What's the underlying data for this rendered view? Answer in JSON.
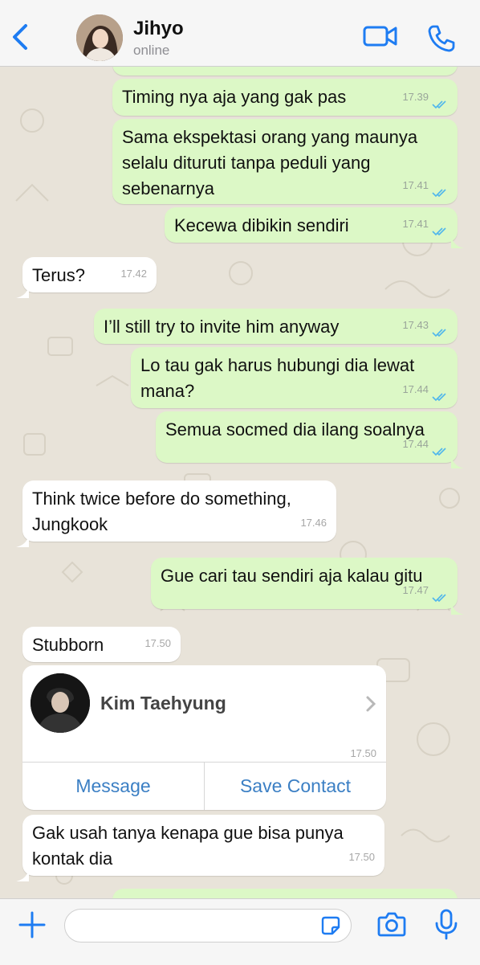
{
  "header": {
    "back_icon": "chevron-left-icon",
    "contact_name": "Jihyo",
    "status": "online",
    "video_icon": "video-camera-icon",
    "call_icon": "phone-icon",
    "accent": "#1e7cf2"
  },
  "messages": [
    {
      "dir": "out",
      "lines": [
        "Timing nya aja yang gak pas"
      ],
      "time": "17.39",
      "read": true
    },
    {
      "dir": "out",
      "lines": [
        "Sama ekspektasi orang yang maunya",
        "selalu dituruti tanpa peduli yang",
        "sebenarnya"
      ],
      "time": "17.41",
      "read": true
    },
    {
      "dir": "out",
      "lines": [
        "Kecewa dibikin sendiri"
      ],
      "time": "17.41",
      "read": true
    },
    {
      "dir": "in",
      "lines": [
        "Terus?"
      ],
      "time": "17.42"
    },
    {
      "dir": "out",
      "lines": [
        "I’ll still try to invite him anyway"
      ],
      "time": "17.43",
      "read": true
    },
    {
      "dir": "out",
      "lines": [
        "Lo tau gak harus hubungi dia lewat",
        "mana?"
      ],
      "time": "17.44",
      "read": true
    },
    {
      "dir": "out",
      "lines": [
        "Semua socmed dia ilang soalnya"
      ],
      "time": "17.44",
      "read": true
    },
    {
      "dir": "in",
      "lines": [
        "Think twice before do something,",
        "Jungkook"
      ],
      "time": "17.46"
    },
    {
      "dir": "out",
      "lines": [
        "Gue cari tau sendiri aja kalau gitu"
      ],
      "time": "17.47",
      "read": true
    },
    {
      "dir": "in",
      "lines": [
        "Stubborn"
      ],
      "time": "17.50"
    },
    {
      "dir": "in",
      "lines": [
        "Gak usah tanya kenapa gue bisa punya",
        "kontak dia"
      ],
      "time": "17.50"
    }
  ],
  "contact_card": {
    "name": "Kim Taehyung",
    "time": "17.50",
    "message_label": "Message",
    "save_label": "Save Contact"
  },
  "composer": {
    "placeholder": "",
    "plus_icon": "plus-icon",
    "sticker_icon": "sticker-icon",
    "camera_icon": "camera-icon",
    "mic_icon": "microphone-icon"
  },
  "colors": {
    "outgoing_bubble": "#dcf8c6",
    "incoming_bubble": "#ffffff",
    "read_ticks": "#4fb6ec",
    "chat_background": "#e8e3d9"
  }
}
